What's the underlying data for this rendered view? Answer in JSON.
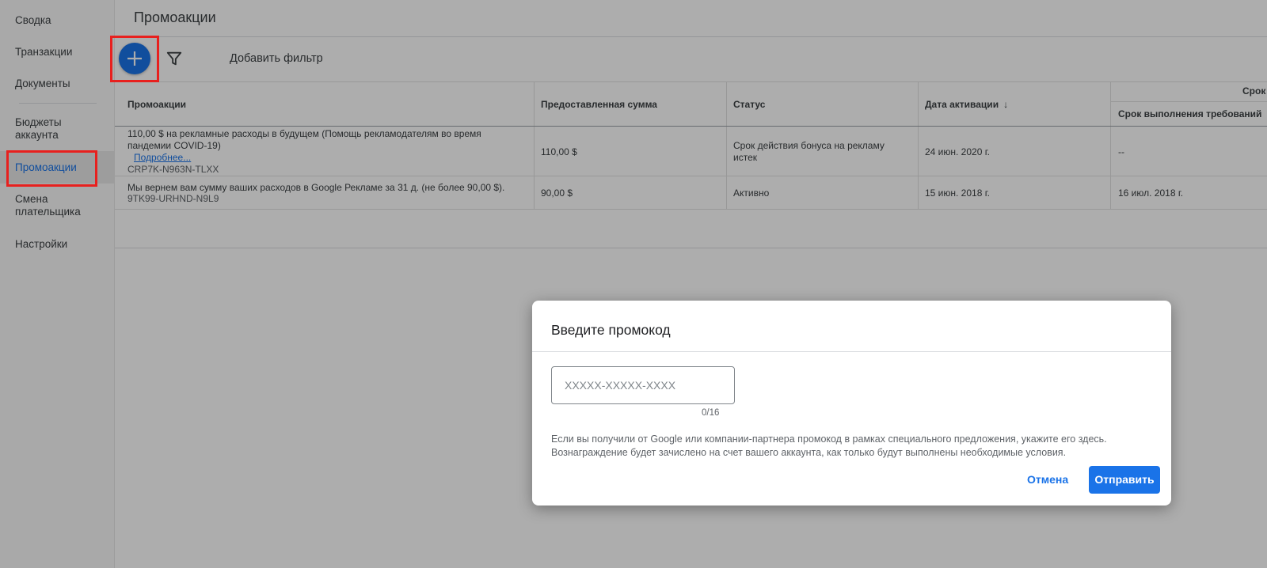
{
  "sidebar": {
    "items": [
      {
        "label": "Сводка"
      },
      {
        "label": "Транзакции"
      },
      {
        "label": "Документы"
      },
      {
        "label": "Бюджеты аккаунта"
      },
      {
        "label": "Промоакции"
      },
      {
        "label": "Смена плательщика"
      },
      {
        "label": "Настройки"
      }
    ],
    "active_index": 4
  },
  "header": {
    "title": "Промоакции"
  },
  "toolbar": {
    "add_icon": "plus-icon",
    "filter_icon": "funnel-icon",
    "add_filter_label": "Добавить фильтр"
  },
  "table": {
    "columns": {
      "promotions": "Промоакции",
      "amount": "Предоставленная сумма",
      "status": "Статус",
      "activation_date": "Дата активации",
      "term_group": "Срок",
      "term_requirements": "Срок выполнения требований"
    },
    "rows": [
      {
        "title": "110,00 $ на рекламные расходы в будущем (Помощь рекламодателям во время пандемии COVID-19)",
        "link": "Подробнее...",
        "code": "CRP7K-N963N-TLXX",
        "amount": "110,00 $",
        "status": "Срок действия бонуса на рекламу истек",
        "activation_date": "24 июн. 2020 г.",
        "requirements_date": "--"
      },
      {
        "title": "Мы вернем вам сумму ваших расходов в Google Рекламе за 31 д. (не более 90,00 $).",
        "code": "9TK99-URHND-N9L9",
        "amount": "90,00 $",
        "status": "Активно",
        "activation_date": "15 июн. 2018 г.",
        "requirements_date": "16 июл. 2018 г."
      }
    ]
  },
  "dialog": {
    "title": "Введите промокод",
    "input_placeholder": "XXXXX-XXXXX-XXXX",
    "input_value": "",
    "counter": "0/16",
    "description_line1": "Если вы получили от Google или компании-партнера промокод в рамках специального предложения, укажите его здесь.",
    "description_line2": "Вознаграждение будет зачислено на счет вашего аккаунта, как только будут выполнены необходимые условия.",
    "cancel_label": "Отмена",
    "submit_label": "Отправить"
  },
  "colors": {
    "accent": "#1a73e8",
    "highlight": "#e8201e"
  }
}
